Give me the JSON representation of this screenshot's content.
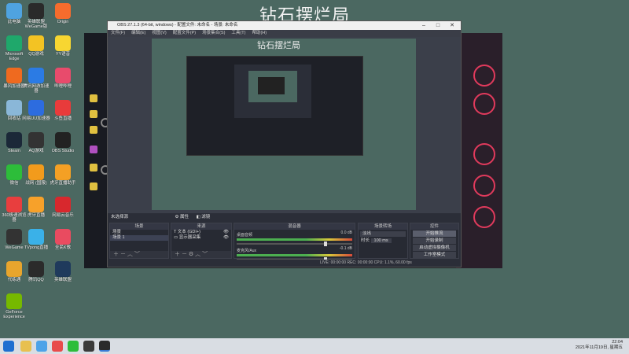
{
  "desktop_title": "钻石摆烂局",
  "desktop_icons": [
    {
      "label": "此电脑",
      "color": "#4fa3e0",
      "name": "pc-icon"
    },
    {
      "label": "英雄联盟WeGame版",
      "color": "#2a2a2a",
      "name": "lol-icon"
    },
    {
      "label": "Origin",
      "color": "#f56c2d",
      "name": "origin-icon"
    },
    {
      "label": "Microsoft Edge",
      "color": "#1fa86b",
      "name": "edge-icon"
    },
    {
      "label": "QQ游戏",
      "color": "#f3c323",
      "name": "qqgame-icon"
    },
    {
      "label": "YY语音",
      "color": "#f7d631",
      "name": "yy-icon"
    },
    {
      "label": "暴风加速器",
      "color": "#ef6a1f",
      "name": "booster-icon"
    },
    {
      "label": "腾讯网游加速器",
      "color": "#2b7be4",
      "name": "tencent-booster-icon"
    },
    {
      "label": "哔哩哔哩",
      "color": "#e84b6c",
      "name": "bilibili-icon"
    },
    {
      "label": "回收站",
      "color": "#8ab7d8",
      "name": "recycle-bin-icon"
    },
    {
      "label": "网易UU加速器",
      "color": "#2d6cdf",
      "name": "uu-icon"
    },
    {
      "label": "斗鱼直播",
      "color": "#e83b3b",
      "name": "douyu-icon"
    },
    {
      "label": "Steam",
      "color": "#1b2838",
      "name": "steam-icon"
    },
    {
      "label": "AQ游戏",
      "color": "#333",
      "name": "aq-icon"
    },
    {
      "label": "OBS Studio",
      "color": "#222",
      "name": "obs-icon"
    },
    {
      "label": "微信",
      "color": "#2dbd3a",
      "name": "wechat-icon"
    },
    {
      "label": "战网 (国服) ",
      "color": "#f29b1c",
      "name": "battlenet-icon"
    },
    {
      "label": "虎牙直播助手",
      "color": "#f4a024",
      "name": "huya-helper-icon"
    },
    {
      "label": "360极速浏览器",
      "color": "#e83e3e",
      "name": "360-icon"
    },
    {
      "label": "虎牙直播",
      "color": "#f7a12a",
      "name": "huya-icon"
    },
    {
      "label": "网易云音乐",
      "color": "#d8282d",
      "name": "netease-music-icon"
    },
    {
      "label": "WeGame",
      "color": "#333",
      "name": "wegame-icon"
    },
    {
      "label": "TVpong直播",
      "color": "#3ab1e8",
      "name": "tvpong-icon"
    },
    {
      "label": "全民K歌",
      "color": "#e94b60",
      "name": "kge-icon"
    },
    {
      "label": "代练通",
      "color": "#e8a52d",
      "name": "dailiantong-icon"
    },
    {
      "label": "腾讯QQ",
      "color": "#2b2b2b",
      "name": "qq-icon"
    },
    {
      "label": "英雄联盟",
      "color": "#1f3a5c",
      "name": "lol2-icon"
    },
    {
      "label": "GeForce Experience",
      "color": "#76b900",
      "name": "geforce-icon"
    }
  ],
  "obs": {
    "window_title": "OBS 27.1.3 (64-bit, windows) - 配置文件: 未命名 - 场景: 未命名",
    "menu": [
      "文件(F)",
      "编辑(E)",
      "视图(V)",
      "配置文件(P)",
      "场景集合(S)",
      "工具(T)",
      "帮助(H)"
    ],
    "preview_title": "钻石摆烂局",
    "no_source": "未选择源",
    "properties": "属性",
    "filters": "滤镜",
    "scenes": {
      "title": "场景",
      "items": [
        "场景",
        "场景 1"
      ]
    },
    "sources": {
      "title": "来源",
      "items": [
        "文本 (GDI+)",
        "显示器采集"
      ]
    },
    "mixer": {
      "title": "混音器",
      "tracks": [
        {
          "name": "桌面音频",
          "level": "0.0 dB"
        },
        {
          "name": "麦克风/Aux",
          "level": "-0.1 dB"
        }
      ]
    },
    "transitions": {
      "title": "场景转场",
      "type": "淡出",
      "duration_label": "时长",
      "duration": "100 ms"
    },
    "controls": {
      "title": "控件",
      "buttons": [
        "开始推流",
        "开始录制",
        "启动虚拟摄像机",
        "工作室模式",
        "设置",
        "退出"
      ]
    },
    "status": "LIVE: 00:00:00   REC: 00:00:00   CPU: 1.1%, 60.00 fps"
  },
  "taskbar": {
    "time": "22:04",
    "date": "2021年11月19日, 星期五"
  }
}
